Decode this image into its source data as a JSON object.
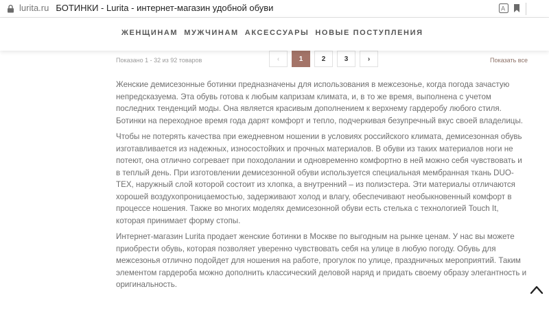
{
  "browser": {
    "domain": "lurita.ru",
    "page_title": "БОТИНКИ - Lurita - интернет-магазин удобной обуви",
    "icons": [
      "lock-icon",
      "translate-icon",
      "bookmark-icon"
    ]
  },
  "nav": {
    "items": [
      "ЖЕНЩИНАМ",
      "МУЖЧИНАМ",
      "АКСЕССУАРЫ",
      "НОВЫЕ ПОСТУПЛЕНИЯ"
    ]
  },
  "listing": {
    "shown_text": "Показано 1 - 32 из 92 товаров",
    "show_all": "Показать все"
  },
  "pagination": {
    "prev": "‹",
    "pages": [
      "1",
      "2",
      "3"
    ],
    "current": "1",
    "next": "›"
  },
  "description": {
    "paragraphs": [
      "Женские демисезонные ботинки предназначены для использования в межсезонье, когда погода зачастую непредсказуема. Эта обувь готова к любым капризам климата, и, в то же время, выполнена с учетом последних тенденций моды. Она является красивым дополнением к верхнему гардеробу любого стиля. Ботинки на переходное время года дарят комфорт и тепло, подчеркивая безупречный вкус своей владелицы.",
      "Чтобы не потерять качества при ежедневном ношении в условиях российского климата, демисезонная обувь изготавливается из надежных, износостойких и прочных материалов. В обуви из таких материалов ноги не потеют, она отлично согревает при походолании и одновременно комфортно в ней можно себя чувствовать и в теплый день. При изготовлении демисезонной обуви используется специальная мембранная ткань DUO-TEX, наружный слой которой состоит из хлопка, а внутренний – из полиэстера. Эти материалы отличаются хорошей воздухопроницаемостью, задерживают холод и влагу, обеспечивают необыкновенный комфорт в процессе ношения. Также во многих моделях демисезонной обуви есть стелька с технологией Touch It, которая принимает форму стопы.",
      "Интернет-магазин Lurita продает женские ботинки в Москве по выгодным на рынке ценам. У нас вы можете приобрести обувь, которая позволяет уверенно чувствовать себя на улице в любую погоду. Обувь для межсезонья отлично подойдет для ношения на работе, прогулок по улице, праздничных мероприятий. Таким элементом гардероба можно дополнить классический деловой наряд и придать своему образу элегантность и оригинальность."
    ]
  },
  "colors": {
    "accent": "#a47468",
    "text": "#6e6e6e",
    "nav_text": "#565656"
  }
}
